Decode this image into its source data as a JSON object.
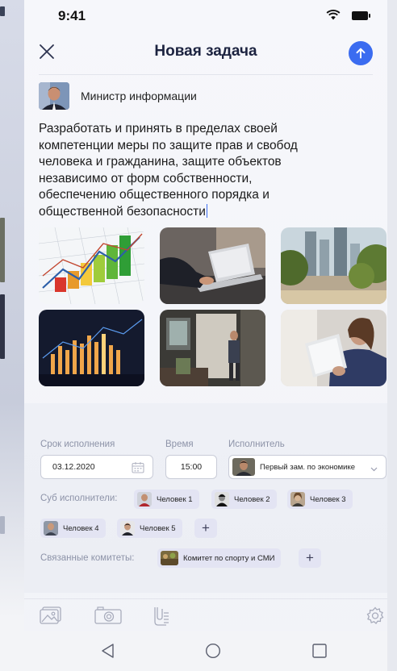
{
  "status_bar": {
    "time": "9:41"
  },
  "header": {
    "title": "Новая задача"
  },
  "author": {
    "name": "Министр информации"
  },
  "task": {
    "text_lines": [
      "Разработать и принять в пределах своей",
      "компетенции меры по защите прав и свобод",
      "человека и гражданина, защите объектов",
      "независимо от форм собственности,",
      "обеспечению общественного порядка и",
      "общественной безопасности"
    ]
  },
  "form": {
    "deadline_label": "Срок исполнения",
    "deadline_value": "03.12.2020",
    "time_label": "Время",
    "time_value": "15:00",
    "executor_label": "Исполнитель",
    "executor_value": "Первый зам. по экономике",
    "sub_label": "Суб исполнители:",
    "sub_executors": [
      "Человек 1",
      "Человек 2",
      "Человек 3",
      "Человек 4",
      "Человек 5"
    ],
    "committees_label": "Связанные комитеты:",
    "committee": "Комитет по спорту и СМИ",
    "plus": "+"
  },
  "icons": {
    "close": "close-icon",
    "send": "arrow-up-icon",
    "gallery": "gallery-icon",
    "camera": "camera-icon",
    "attach": "file-attach-icon",
    "settings": "gear-icon"
  },
  "colors": {
    "accent": "#3b6cf0",
    "chip": "#e3e4f3"
  }
}
